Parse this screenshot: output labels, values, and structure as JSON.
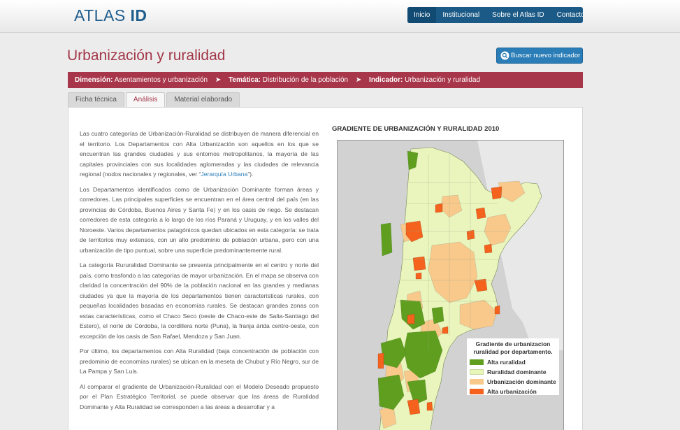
{
  "header": {
    "logo_light": "ATLAS",
    "logo_bold": "ID",
    "nav": [
      "Inicio",
      "Institucional",
      "Sobre el Atlas ID",
      "Contacto"
    ],
    "nav_active": "Inicio"
  },
  "page": {
    "title": "Urbanización y ruralidad",
    "search_button": "Buscar nuevo indicador"
  },
  "breadcrumb": {
    "dimension_label": "Dimensión:",
    "dimension_value": "Asentamientos y urbanización",
    "tematica_label": "Temática:",
    "tematica_value": "Distribución de la población",
    "indicador_label": "Indicador:",
    "indicador_value": "Urbanización y ruralidad"
  },
  "tabs": [
    "Ficha técnica",
    "Análisis",
    "Material elaborado"
  ],
  "tab_active": "Análisis",
  "text": {
    "p1a": "Las cuatro categorías de Urbanización-Ruralidad se distribuyen de manera diferencial en el territorio. Los Departamentos con Alta Urbanización son aquellos en los que se encuentran las grandes ciudades y sus entornos metropolitanos, la mayoría de las capitales provinciales con sus localidades aglomeradas y las ciudades de relevancia regional (nodos nacionales y regionales, ver “",
    "p1_link": "Jerarquía Urbana",
    "p1b": "”).",
    "p2": "Los Departamentos identificados como de Urbanización Dominante forman áreas y corredores. Las principales superficies se encuentran en el área central del país (en las provincias de Córdoba, Buenos Aires y Santa Fe) y  en los oasis de riego. Se destacan corredores de esta categoría a lo largo de los ríos Paraná y Uruguay, y en los valles del Noroeste. Varios departamentos patagónicos quedan ubicados en esta categoría: se trata de territorios muy extensos, con un alto predominio de población urbana, pero con una urbanización de tipo puntual, sobre una superficie predominantemente rural.",
    "p3": "La categoría Rururalidad Dominante se presenta principalmente en el centro y norte del país, como trasfondo a las categorías de mayor urbanización. En el mapa se observa con claridad la concentración del 90% de la población nacional en las grandes y medianas ciudades ya que la mayoría de los departamentos tienen características rurales, con pequeñas localidades basadas en economías rurales. Se destacan grandes zonas con estas características, como el Chaco Seco (oeste de Chaco-este de Salta-Santiago del Estero), el norte de Córdoba, la cordillera norte (Puna), la franja árida centro-oeste, con excepción de los oasis de San Rafael, Mendoza y San Juan.",
    "p4": "Por último, los departamentos con Alta Ruralidad (baja concentración de población con predominio de economías rurales) se ubican en la meseta de Chubut y Río Negro, sur de La Pampa y San Luis.",
    "p5": "Al comparar el gradiente de Urbanización-Ruralidad con el Modelo Deseado propuesto por el Plan Estratégico Territorial, se puede observar que las áreas de Ruralidad Dominante y Alta Ruralidad se corresponden a las áreas a desarrollar y a"
  },
  "map": {
    "title": "GRADIENTE DE URBANIZACIÓN Y RURALIDAD 2010",
    "legend_title_1": "Gradiente de urbanizacion",
    "legend_title_2": "ruralidad por departamento.",
    "legend": [
      {
        "label": "Alta ruralidad",
        "color": "#5f9e1f"
      },
      {
        "label": "Ruralidad dominante",
        "color": "#e8f6b8"
      },
      {
        "label": "Urbanización dominante",
        "color": "#f8c98a"
      },
      {
        "label": "Alta urbanización",
        "color": "#f4621e"
      }
    ]
  }
}
